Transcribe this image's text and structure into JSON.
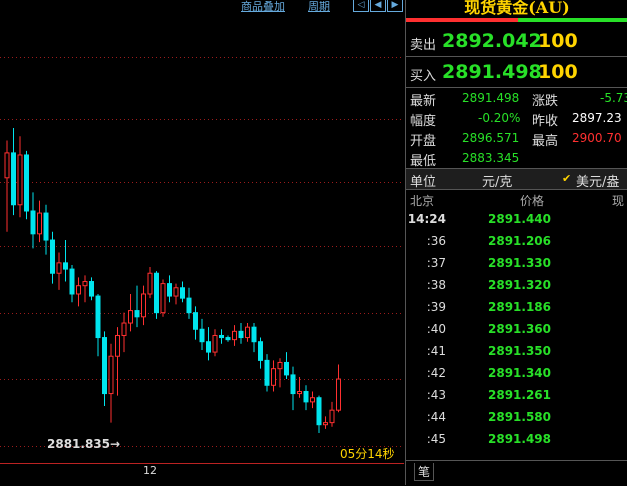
{
  "top": {
    "overlay_label": "商品叠加",
    "period_label": "周期"
  },
  "chart": {
    "low_marker": "2881.835→",
    "timer": "05分14秒",
    "x_tick": "12",
    "bull_color": "#ff3030",
    "bear_color": "#00e5ee",
    "candles": [
      {
        "o": 2893.6,
        "h": 2895.4,
        "l": 2891.0,
        "c": 2894.8
      },
      {
        "o": 2894.8,
        "h": 2896.0,
        "l": 2891.8,
        "c": 2892.3
      },
      {
        "o": 2892.3,
        "h": 2895.6,
        "l": 2891.7,
        "c": 2894.7
      },
      {
        "o": 2894.7,
        "h": 2894.9,
        "l": 2891.6,
        "c": 2892.0
      },
      {
        "o": 2892.0,
        "h": 2892.9,
        "l": 2890.2,
        "c": 2890.9
      },
      {
        "o": 2890.9,
        "h": 2892.5,
        "l": 2890.5,
        "c": 2891.9
      },
      {
        "o": 2891.9,
        "h": 2892.3,
        "l": 2889.9,
        "c": 2890.6
      },
      {
        "o": 2890.6,
        "h": 2891.0,
        "l": 2888.5,
        "c": 2889.0
      },
      {
        "o": 2889.0,
        "h": 2890.0,
        "l": 2888.2,
        "c": 2889.5
      },
      {
        "o": 2889.5,
        "h": 2890.6,
        "l": 2888.6,
        "c": 2889.2
      },
      {
        "o": 2889.2,
        "h": 2889.4,
        "l": 2887.6,
        "c": 2888.0
      },
      {
        "o": 2888.0,
        "h": 2888.8,
        "l": 2887.4,
        "c": 2888.4
      },
      {
        "o": 2888.4,
        "h": 2888.9,
        "l": 2887.6,
        "c": 2888.6
      },
      {
        "o": 2888.6,
        "h": 2888.8,
        "l": 2887.7,
        "c": 2887.9
      },
      {
        "o": 2887.9,
        "h": 2888.0,
        "l": 2885.0,
        "c": 2885.9
      },
      {
        "o": 2885.9,
        "h": 2886.2,
        "l": 2882.6,
        "c": 2883.2
      },
      {
        "o": 2883.2,
        "h": 2885.6,
        "l": 2881.8,
        "c": 2885.0
      },
      {
        "o": 2885.0,
        "h": 2886.4,
        "l": 2883.1,
        "c": 2886.0
      },
      {
        "o": 2886.0,
        "h": 2887.1,
        "l": 2885.2,
        "c": 2886.6
      },
      {
        "o": 2886.6,
        "h": 2888.0,
        "l": 2886.2,
        "c": 2887.2
      },
      {
        "o": 2887.2,
        "h": 2888.4,
        "l": 2886.4,
        "c": 2886.9
      },
      {
        "o": 2886.9,
        "h": 2888.4,
        "l": 2886.5,
        "c": 2888.0
      },
      {
        "o": 2888.0,
        "h": 2889.3,
        "l": 2887.8,
        "c": 2889.0
      },
      {
        "o": 2889.0,
        "h": 2889.1,
        "l": 2886.8,
        "c": 2887.1
      },
      {
        "o": 2887.1,
        "h": 2888.7,
        "l": 2886.9,
        "c": 2888.5
      },
      {
        "o": 2888.5,
        "h": 2888.9,
        "l": 2887.6,
        "c": 2887.9
      },
      {
        "o": 2887.9,
        "h": 2888.5,
        "l": 2887.5,
        "c": 2888.3
      },
      {
        "o": 2888.3,
        "h": 2888.6,
        "l": 2887.6,
        "c": 2887.8
      },
      {
        "o": 2887.8,
        "h": 2888.3,
        "l": 2886.8,
        "c": 2887.1
      },
      {
        "o": 2887.1,
        "h": 2887.4,
        "l": 2885.8,
        "c": 2886.3
      },
      {
        "o": 2886.3,
        "h": 2886.8,
        "l": 2885.3,
        "c": 2885.7
      },
      {
        "o": 2885.7,
        "h": 2886.4,
        "l": 2884.8,
        "c": 2885.2
      },
      {
        "o": 2885.2,
        "h": 2886.3,
        "l": 2885.0,
        "c": 2886.0
      },
      {
        "o": 2886.0,
        "h": 2886.3,
        "l": 2885.6,
        "c": 2885.9
      },
      {
        "o": 2885.9,
        "h": 2886.0,
        "l": 2885.7,
        "c": 2885.8
      },
      {
        "o": 2885.8,
        "h": 2886.5,
        "l": 2885.5,
        "c": 2886.2
      },
      {
        "o": 2886.2,
        "h": 2886.6,
        "l": 2885.6,
        "c": 2885.9
      },
      {
        "o": 2885.9,
        "h": 2886.6,
        "l": 2885.7,
        "c": 2886.4
      },
      {
        "o": 2886.4,
        "h": 2886.6,
        "l": 2885.2,
        "c": 2885.7
      },
      {
        "o": 2885.7,
        "h": 2885.9,
        "l": 2884.4,
        "c": 2884.8
      },
      {
        "o": 2884.8,
        "h": 2885.1,
        "l": 2883.3,
        "c": 2883.6
      },
      {
        "o": 2883.6,
        "h": 2884.8,
        "l": 2883.3,
        "c": 2884.4
      },
      {
        "o": 2884.4,
        "h": 2884.9,
        "l": 2883.5,
        "c": 2884.7
      },
      {
        "o": 2884.7,
        "h": 2885.2,
        "l": 2883.9,
        "c": 2884.1
      },
      {
        "o": 2884.1,
        "h": 2884.5,
        "l": 2882.4,
        "c": 2883.2
      },
      {
        "o": 2883.2,
        "h": 2884.0,
        "l": 2883.0,
        "c": 2883.3
      },
      {
        "o": 2883.3,
        "h": 2883.6,
        "l": 2882.4,
        "c": 2882.8
      },
      {
        "o": 2882.8,
        "h": 2883.3,
        "l": 2882.5,
        "c": 2883.0
      },
      {
        "o": 2883.0,
        "h": 2883.1,
        "l": 2881.3,
        "c": 2881.7
      },
      {
        "o": 2881.7,
        "h": 2882.1,
        "l": 2881.5,
        "c": 2881.8
      },
      {
        "o": 2881.8,
        "h": 2882.8,
        "l": 2881.6,
        "c": 2882.4
      },
      {
        "o": 2882.4,
        "h": 2884.6,
        "l": 2882.3,
        "c": 2883.9
      }
    ]
  },
  "panel": {
    "title": "现货黄金(AU)",
    "sell": {
      "label": "卖出",
      "price": "2892.042",
      "vol": "100"
    },
    "buy": {
      "label": "买入",
      "price": "2891.498",
      "vol": "100"
    },
    "stats": {
      "latest_k": "最新",
      "latest_v": "2891.498",
      "change_k": "涨跌",
      "change_v": "-5.73",
      "range_k": "幅度",
      "range_v": "-0.20%",
      "prevclose_k": "昨收",
      "prevclose_v": "2897.23",
      "open_k": "开盘",
      "open_v": "2896.571",
      "high_k": "最高",
      "high_v": "2900.70",
      "low_k": "最低",
      "low_v": "2883.345"
    },
    "unit": {
      "label": "单位",
      "value": "元/克",
      "check": "✔",
      "alt": "美元/盎"
    },
    "header": {
      "city": "北京",
      "price": "价格",
      "now": "现"
    },
    "ticks": [
      {
        "t": "14:24",
        "p": "2891.440"
      },
      {
        "t": ":36",
        "p": "2891.206"
      },
      {
        "t": ":37",
        "p": "2891.330"
      },
      {
        "t": ":38",
        "p": "2891.320"
      },
      {
        "t": ":39",
        "p": "2891.186"
      },
      {
        "t": ":40",
        "p": "2891.360"
      },
      {
        "t": ":41",
        "p": "2891.350"
      },
      {
        "t": ":42",
        "p": "2891.340"
      },
      {
        "t": ":43",
        "p": "2891.261"
      },
      {
        "t": ":44",
        "p": "2891.580"
      },
      {
        "t": ":45",
        "p": "2891.498"
      }
    ],
    "footer_tab": "笔"
  }
}
